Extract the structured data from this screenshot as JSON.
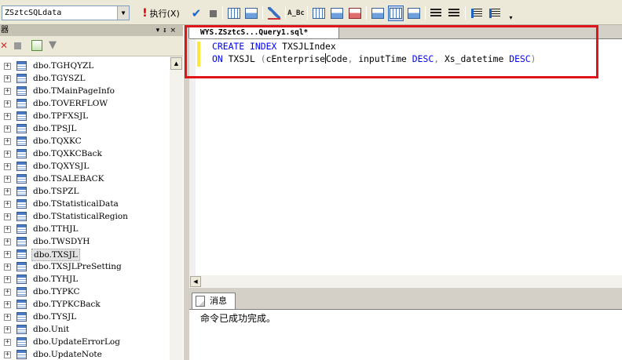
{
  "toolbar": {
    "database": "ZSztcSQLdata",
    "execute_label": "执行(X)"
  },
  "explorer": {
    "header_label": "器",
    "items": [
      {
        "label": "dbo.TGHQYZL",
        "selected": false
      },
      {
        "label": "dbo.TGYSZL",
        "selected": false
      },
      {
        "label": "dbo.TMainPageInfo",
        "selected": false
      },
      {
        "label": "dbo.TOVERFLOW",
        "selected": false
      },
      {
        "label": "dbo.TPFXSJL",
        "selected": false
      },
      {
        "label": "dbo.TPSJL",
        "selected": false
      },
      {
        "label": "dbo.TQXKC",
        "selected": false
      },
      {
        "label": "dbo.TQXKCBack",
        "selected": false
      },
      {
        "label": "dbo.TQXYSJL",
        "selected": false
      },
      {
        "label": "dbo.TSALEBACK",
        "selected": false
      },
      {
        "label": "dbo.TSPZL",
        "selected": false
      },
      {
        "label": "dbo.TStatisticalData",
        "selected": false
      },
      {
        "label": "dbo.TStatisticalRegion",
        "selected": false
      },
      {
        "label": "dbo.TTHJL",
        "selected": false
      },
      {
        "label": "dbo.TWSDYH",
        "selected": false
      },
      {
        "label": "dbo.TXSJL",
        "selected": true
      },
      {
        "label": "dbo.TXSJLPreSetting",
        "selected": false
      },
      {
        "label": "dbo.TYHJL",
        "selected": false
      },
      {
        "label": "dbo.TYPKC",
        "selected": false
      },
      {
        "label": "dbo.TYPKCBack",
        "selected": false
      },
      {
        "label": "dbo.TYSJL",
        "selected": false
      },
      {
        "label": "dbo.Unit",
        "selected": false
      },
      {
        "label": "dbo.UpdateErrorLog",
        "selected": false
      },
      {
        "label": "dbo.UpdateNote",
        "selected": false
      }
    ]
  },
  "editor": {
    "tab_title": "WYS.ZSztcS...Query1.sql*",
    "line1": {
      "kw1": "CREATE",
      "kw2": "INDEX",
      "name": "TXSJLIndex"
    },
    "line2": {
      "kw_on": "ON",
      "table": "TXSJL",
      "paren_open": "(",
      "col1_a": "cEnterprise",
      "col1_b": "Code",
      "comma1": ",",
      "col2": "inputTime",
      "desc1": "DESC",
      "comma2": ",",
      "col3": "Xs_datetime",
      "desc2": "DESC",
      "paren_close": ")"
    },
    "highlight_color": "#e0151c"
  },
  "messages": {
    "tab_label": "消息",
    "text": "命令已成功完成。"
  }
}
